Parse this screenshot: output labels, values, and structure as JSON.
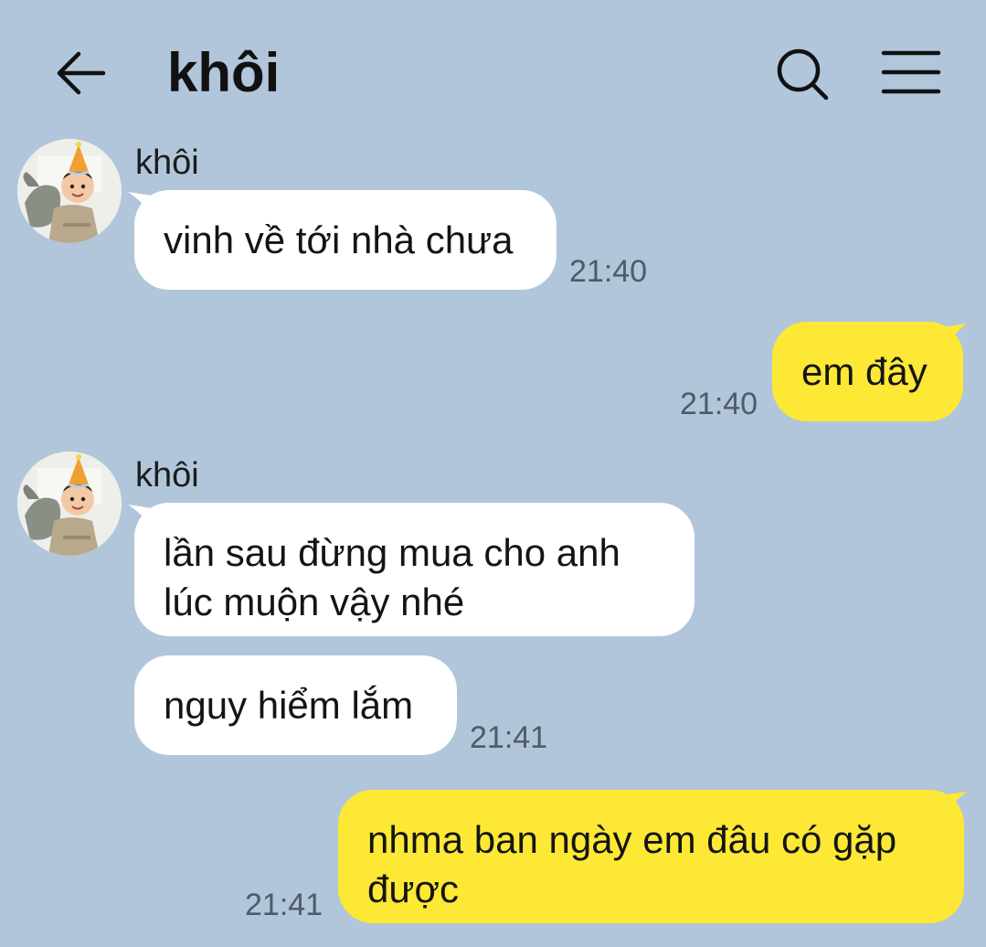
{
  "header": {
    "title": "khôi",
    "back_icon": "back-arrow-icon",
    "search_icon": "search-icon",
    "menu_icon": "hamburger-menu-icon"
  },
  "messages": [
    {
      "direction": "in",
      "sender": "khôi",
      "text": "vinh về tới nhà chưa",
      "time": "21:40"
    },
    {
      "direction": "out",
      "text": "em đây",
      "time": "21:40"
    },
    {
      "direction": "in",
      "sender": "khôi",
      "lines": [
        "lần sau đừng mua cho anh",
        "lúc muộn vậy nhé"
      ]
    },
    {
      "direction": "in",
      "text": "nguy hiểm lắm",
      "time": "21:41"
    },
    {
      "direction": "out",
      "lines": [
        "nhma ban ngày em đâu có gặp",
        "được"
      ],
      "time": "21:41"
    }
  ],
  "colors": {
    "background": "#b1c6da",
    "incoming_bubble": "#ffffff",
    "outgoing_bubble": "#fde935",
    "timestamp": "#4f5b66"
  }
}
